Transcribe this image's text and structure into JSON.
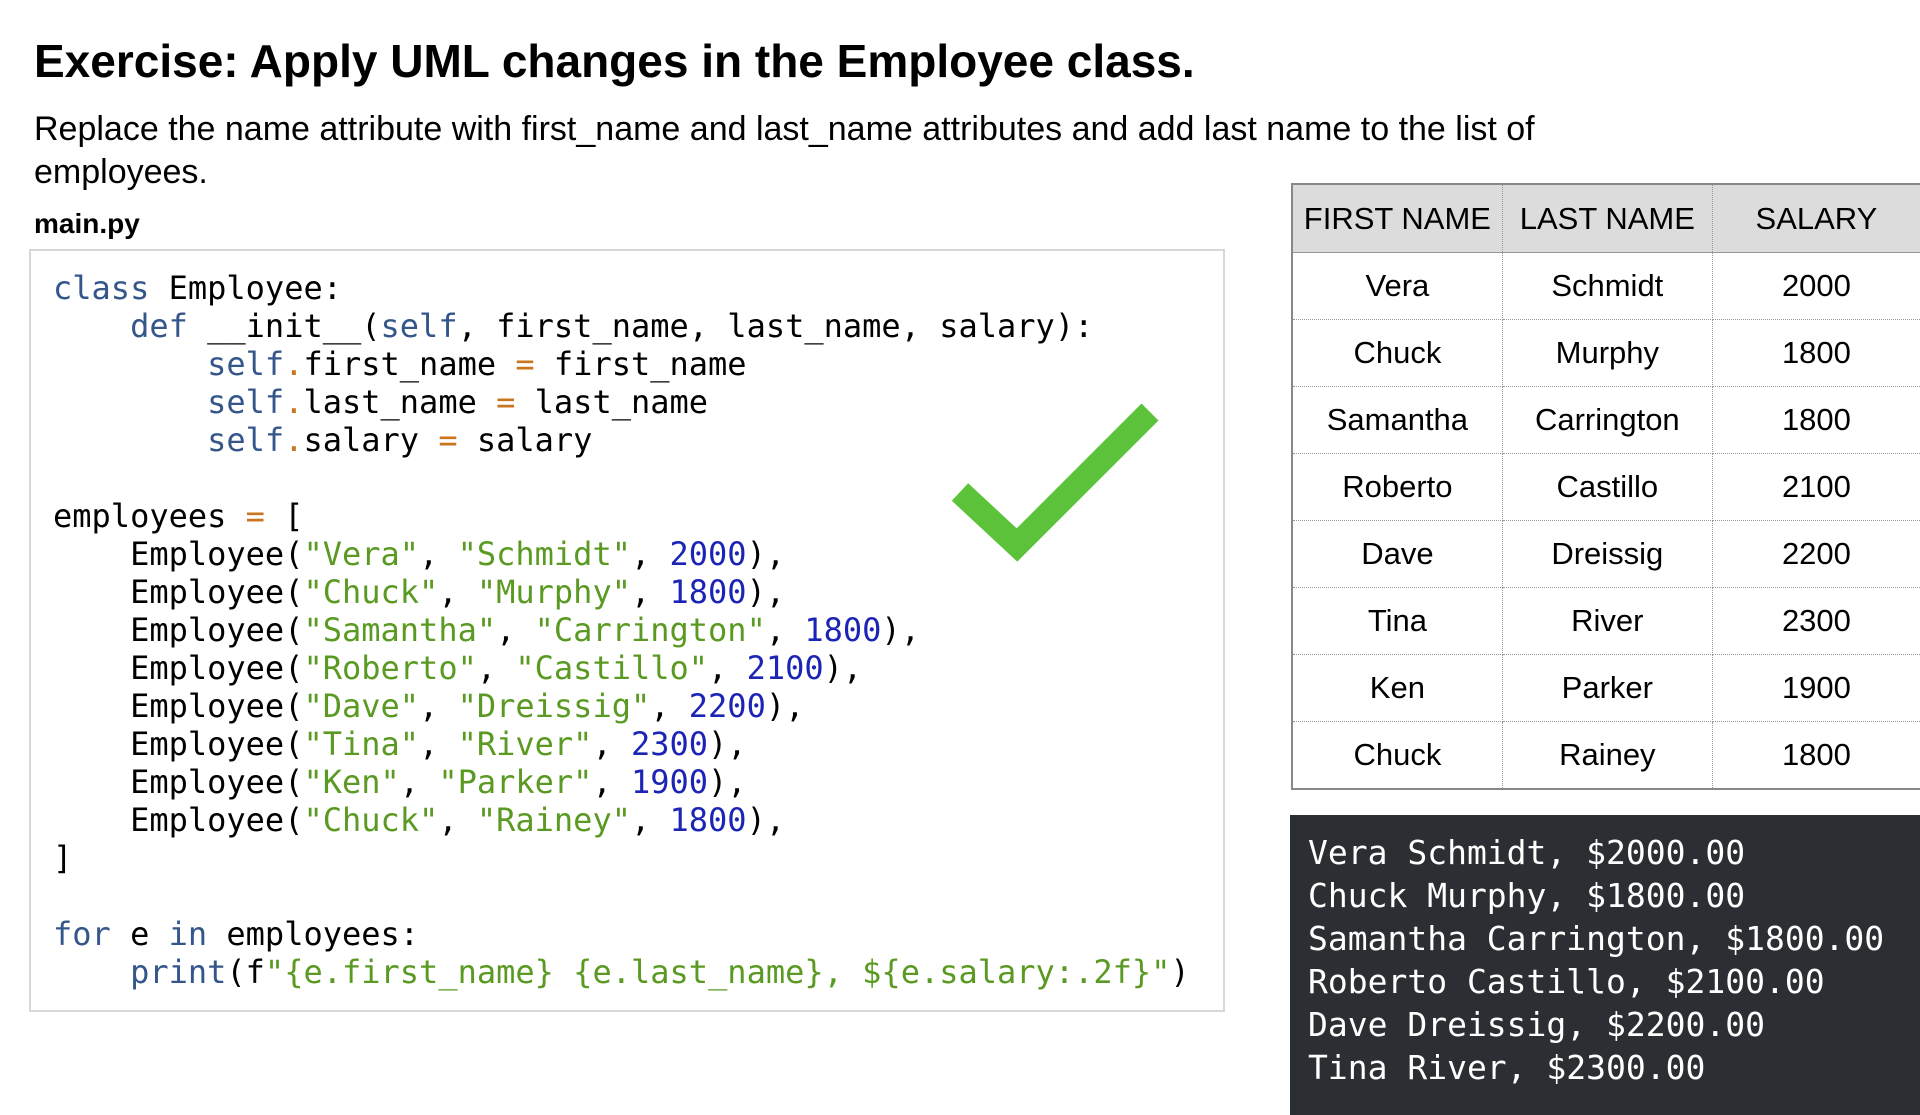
{
  "title": "Exercise: Apply UML changes in the Employee class.",
  "description": "Replace the name attribute with first_name and last_name attributes and add last name to the list of employees.",
  "editor": {
    "filename": "main.py",
    "code": {
      "l1_kw": "class",
      "l1_rest": " Employee:",
      "l2_def": "def",
      "l2_a": " __init__(",
      "l2_self": "self",
      "l2_b": ", first_name, last_name, salary):",
      "self": "self",
      "dot": ".",
      "eq": "=",
      "l3_a": "first_name ",
      "l3_b": " first_name",
      "l4_a": "last_name ",
      "l4_b": " last_name",
      "l5_a": "salary ",
      "l5_b": " salary",
      "emp_a": "employees ",
      "emp_b": " [",
      "ctor": "Employee(",
      "comma": ", ",
      "close": "),",
      "bracket": "]",
      "for": "for",
      "e": " e ",
      "in": "in",
      "for_rest": " employees:",
      "print": "print",
      "paren": "(",
      "fstr_f": "f",
      "fstr": "\"{e.first_name} {e.last_name}, ${e.salary:.2f}\"",
      "print_close": ")",
      "rows": [
        {
          "first": "\"Vera\"",
          "last": "\"Schmidt\"",
          "salary": "2000"
        },
        {
          "first": "\"Chuck\"",
          "last": "\"Murphy\"",
          "salary": "1800"
        },
        {
          "first": "\"Samantha\"",
          "last": "\"Carrington\"",
          "salary": "1800"
        },
        {
          "first": "\"Roberto\"",
          "last": "\"Castillo\"",
          "salary": "2100"
        },
        {
          "first": "\"Dave\"",
          "last": "\"Dreissig\"",
          "salary": "2200"
        },
        {
          "first": "\"Tina\"",
          "last": "\"River\"",
          "salary": "2300"
        },
        {
          "first": "\"Ken\"",
          "last": "\"Parker\"",
          "salary": "1900"
        },
        {
          "first": "\"Chuck\"",
          "last": "\"Rainey\"",
          "salary": "1800"
        }
      ]
    }
  },
  "check_icon": "check-mark-icon",
  "check_color": "#5cc23a",
  "table": {
    "headers": [
      "FIRST NAME",
      "LAST NAME",
      "SALARY"
    ],
    "rows": [
      [
        "Vera",
        "Schmidt",
        "2000"
      ],
      [
        "Chuck",
        "Murphy",
        "1800"
      ],
      [
        "Samantha",
        "Carrington",
        "1800"
      ],
      [
        "Roberto",
        "Castillo",
        "2100"
      ],
      [
        "Dave",
        "Dreissig",
        "2200"
      ],
      [
        "Tina",
        "River",
        "2300"
      ],
      [
        "Ken",
        "Parker",
        "1900"
      ],
      [
        "Chuck",
        "Rainey",
        "1800"
      ]
    ]
  },
  "output": {
    "lines": [
      "Vera Schmidt, $2000.00",
      "Chuck Murphy, $1800.00",
      "Samantha Carrington, $1800.00",
      "Roberto Castillo, $2100.00",
      "Dave Dreissig, $2200.00",
      "Tina River, $2300.00"
    ]
  }
}
